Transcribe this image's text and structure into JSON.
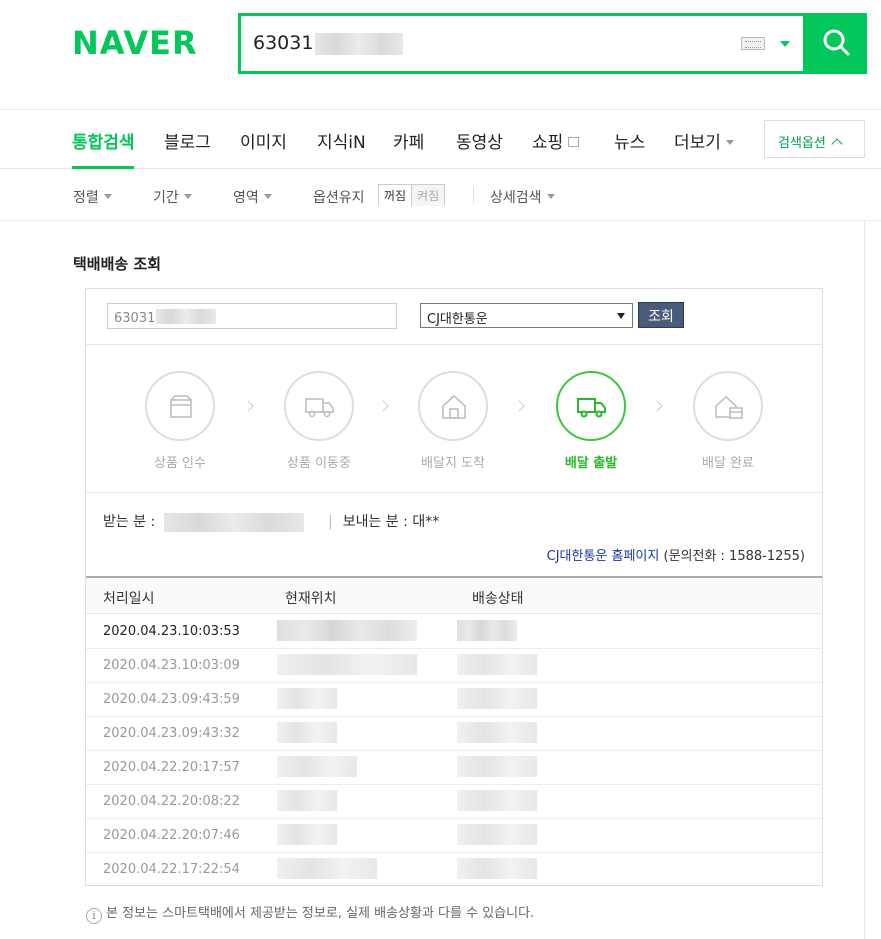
{
  "brand": {
    "logo": "NAVER",
    "accent": "#03c75a"
  },
  "search": {
    "query_prefix": "63031"
  },
  "tabs": [
    {
      "label": "통합검색",
      "active": true
    },
    {
      "label": "블로그"
    },
    {
      "label": "이미지"
    },
    {
      "label": "지식iN"
    },
    {
      "label": "카페"
    },
    {
      "label": "동영상"
    },
    {
      "label": "쇼핑"
    },
    {
      "label": "뉴스"
    },
    {
      "label": "더보기"
    }
  ],
  "search_options_label": "검색옵션",
  "filters": {
    "sort": "정렬",
    "period": "기간",
    "area": "영역",
    "keep_option": "옵션유지",
    "off": "꺼짐",
    "on": "켜짐",
    "detail": "상세검색"
  },
  "tracking": {
    "title": "택배배송 조회",
    "invoice_prefix": "63031",
    "carrier": "CJ대한통운",
    "query_button": "조회",
    "steps": [
      {
        "label": "상품 인수",
        "icon": "box-icon"
      },
      {
        "label": "상품 이동중",
        "icon": "truck-icon"
      },
      {
        "label": "배달지 도착",
        "icon": "house-icon"
      },
      {
        "label": "배달 출발",
        "icon": "truck-icon",
        "active": true
      },
      {
        "label": "배달 완료",
        "icon": "house-box-icon"
      }
    ],
    "receiver_label": "받는 분 :",
    "sender_label": "보내는 분 :",
    "sender_value": "대**",
    "home_link": "CJ대한통운 홈페이지",
    "phone": "(문의전화 : 1588-1255)",
    "columns": [
      "처리일시",
      "현재위치",
      "배송상태"
    ],
    "rows": [
      "2020.04.23.10:03:53",
      "2020.04.23.10:03:09",
      "2020.04.23.09:43:59",
      "2020.04.23.09:43:32",
      "2020.04.22.20:17:57",
      "2020.04.22.20:08:22",
      "2020.04.22.20:07:46",
      "2020.04.22.17:22:54"
    ],
    "notice": "본 정보는 스마트택배에서 제공받는 정보로, 실제 배송상황과 다를 수 있습니다."
  }
}
